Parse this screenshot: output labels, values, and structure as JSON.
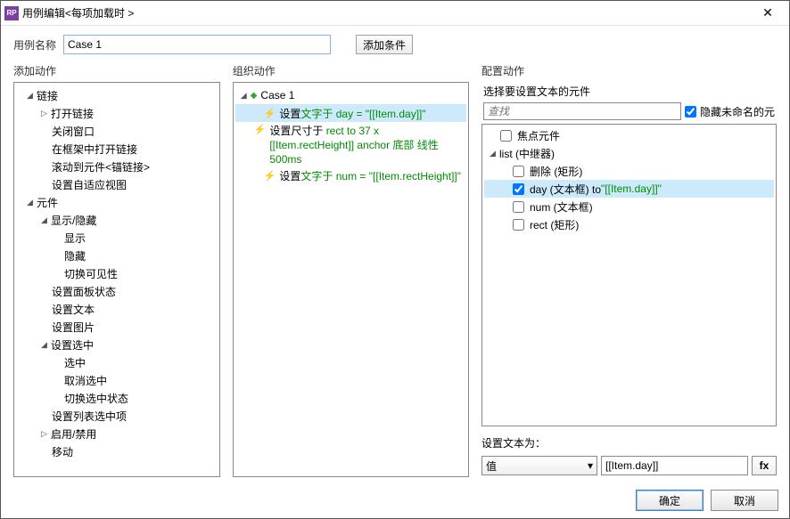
{
  "titlebar": {
    "title": "用例编辑<每项加载时 >"
  },
  "toprow": {
    "name_label": "用例名称",
    "name_value": "Case 1",
    "add_cond": "添加条件"
  },
  "columns": {
    "left": "添加动作",
    "mid": "组织动作",
    "right": "配置动作"
  },
  "left_tree": {
    "link": {
      "label": "链接",
      "open": "打开链接",
      "close_win": "关闭窗口",
      "open_in_frame": "在框架中打开链接",
      "scroll_anchor": "滚动到元件<锚链接>",
      "adaptive": "设置自适应视图"
    },
    "widget": {
      "label": "元件",
      "show_hide": {
        "label": "显示/隐藏",
        "show": "显示",
        "hide": "隐藏",
        "toggle": "切换可见性"
      },
      "panel_state": "设置面板状态",
      "set_text": "设置文本",
      "set_image": "设置图片",
      "set_selected": {
        "label": "设置选中",
        "select": "选中",
        "deselect": "取消选中",
        "toggle": "切换选中状态"
      },
      "set_list_sel": "设置列表选中项",
      "enable_disable": "启用/禁用",
      "move": "移动"
    }
  },
  "mid": {
    "case_label": "Case 1",
    "a1_prefix": "设置 ",
    "a1_green": "文字于 day = \"[[Item.day]]\"",
    "a2_prefix": "设置尺寸于 ",
    "a2_green": "rect to 37 x [[Item.rectHeight]] anchor 底部 线性 500ms",
    "a3_prefix": "设置 ",
    "a3_green": "文字于 num = \"[[Item.rectHeight]]\""
  },
  "cfg_header": "选择要设置文本的元件",
  "search_placeholder": "查找",
  "hide_unnamed": "隐藏未命名的元",
  "targets": {
    "focus": "焦点元件",
    "list": "list (中继器)",
    "del": "删除 (矩形)",
    "day_pre": "day (文本框) to ",
    "day_green": "\"[[Item.day]]\"",
    "num": "num (文本框)",
    "rect": "rect (矩形)"
  },
  "set_text_label": "设置文本为：",
  "dropdown_value": "值",
  "value_input": "[[Item.day]]",
  "fx": "fx",
  "footer": {
    "ok": "确定",
    "cancel": "取消"
  }
}
